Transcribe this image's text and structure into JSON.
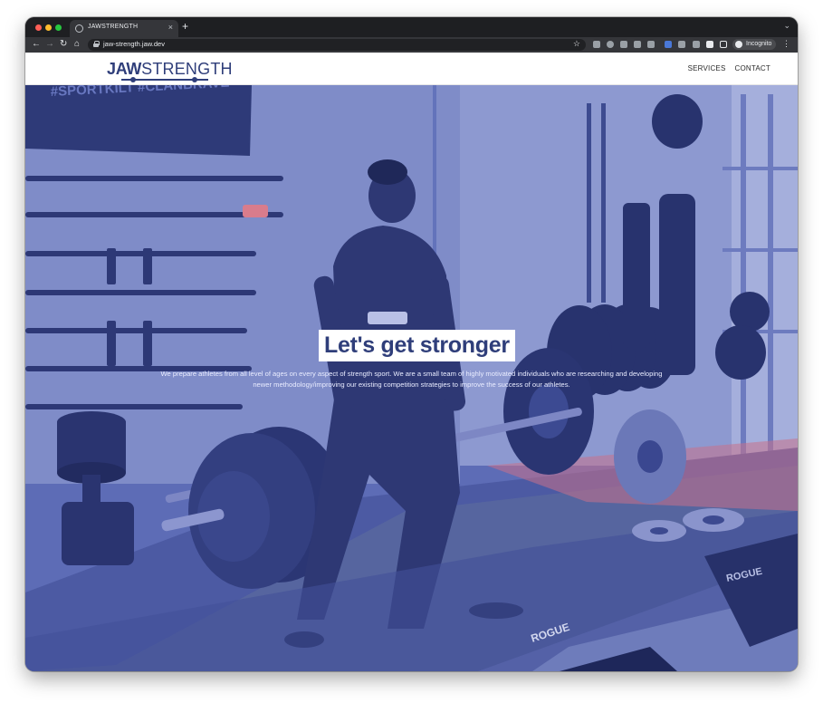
{
  "browser": {
    "tab_title": "JAWSTRENGTH",
    "tab_close": "×",
    "new_tab": "+",
    "url": "jaw-strength.jaw.dev",
    "incognito_label": "Incognito"
  },
  "site": {
    "logo": {
      "bold": "JAW",
      "light": "STRENGTH"
    },
    "nav": [
      {
        "label": "SERVICES"
      },
      {
        "label": "CONTACT"
      }
    ],
    "hero": {
      "headline": "Let's get stronger",
      "description": "We prepare athletes from all level of ages on every aspect of strength sport. We are a small team of highly motivated individuals who are researching and developing newer methodology/improving our existing competition strategies to improve the success of our athletes.",
      "banner_text": "#SPORTKILT #CLANBRAVE",
      "floor_brand": "ROGUE",
      "bench_brand": "ROGUE"
    }
  },
  "colors": {
    "brand_navy": "#2f3e7a",
    "hero_tint": "#4a5aa6"
  },
  "icons": [
    "close-icon",
    "plus-icon",
    "back-icon",
    "forward-icon",
    "reload-icon",
    "home-icon",
    "lock-icon",
    "star-icon",
    "incognito-icon",
    "menu-icon"
  ]
}
